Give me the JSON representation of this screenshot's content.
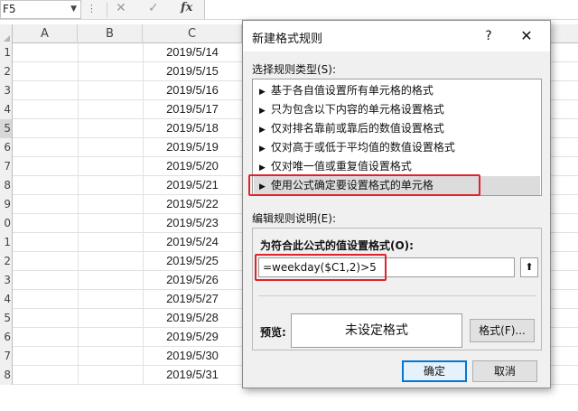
{
  "excel": {
    "name_box": "F5",
    "formula_bar": {
      "cancel_icon": "close-icon",
      "enter_icon": "check-icon",
      "fx_label": "fx",
      "value": ""
    },
    "columns": [
      "A",
      "B",
      "C"
    ],
    "row_numbers": [
      "1",
      "2",
      "3",
      "4",
      "5",
      "6",
      "7",
      "8",
      "9",
      "0",
      "1",
      "2",
      "3",
      "4",
      "5",
      "6",
      "7",
      "8"
    ],
    "dates": [
      "2019/5/14",
      "2019/5/15",
      "2019/5/16",
      "2019/5/17",
      "2019/5/18",
      "2019/5/19",
      "2019/5/20",
      "2019/5/21",
      "2019/5/22",
      "2019/5/23",
      "2019/5/24",
      "2019/5/25",
      "2019/5/26",
      "2019/5/27",
      "2019/5/28",
      "2019/5/29",
      "2019/5/30",
      "2019/5/31"
    ]
  },
  "dialog": {
    "title": "新建格式规则",
    "help_label": "?",
    "close_label": "✕",
    "rule_type_label": "选择规则类型(S):",
    "rule_types": [
      "基于各自值设置所有单元格的格式",
      "只为包含以下内容的单元格设置格式",
      "仅对排名靠前或靠后的数值设置格式",
      "仅对高于或低于平均值的数值设置格式",
      "仅对唯一值或重复值设置格式",
      "使用公式确定要设置格式的单元格"
    ],
    "selected_rule_index": 5,
    "edit_desc_label": "编辑规则说明(E):",
    "formula_label": "为符合此公式的值设置格式(O):",
    "formula_value": "=weekday($C1,2)>5",
    "preview_label": "预览:",
    "preview_text": "未设定格式",
    "format_button": "格式(F)...",
    "ok_button": "确定",
    "cancel_button": "取消",
    "highlight_color": "#e0232b",
    "accent_color": "#0078d7"
  }
}
